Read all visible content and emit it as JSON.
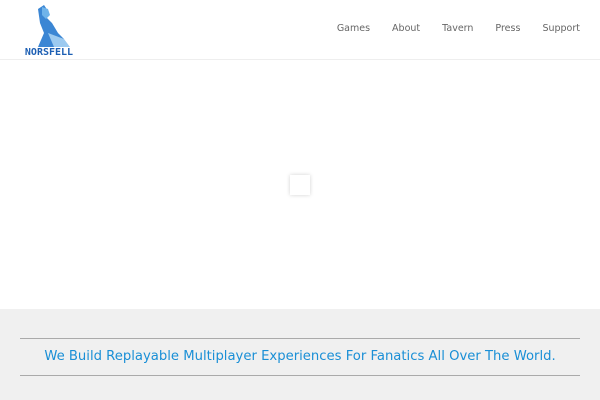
{
  "brand": {
    "logo_text": "NORSFELL",
    "accent": "#1a8fd6"
  },
  "nav": {
    "items": [
      "Games",
      "About",
      "Tavern",
      "Press",
      "Support"
    ]
  },
  "tagline": "We Build Replayable Multiplayer Experiences For Fanatics All Over The World."
}
